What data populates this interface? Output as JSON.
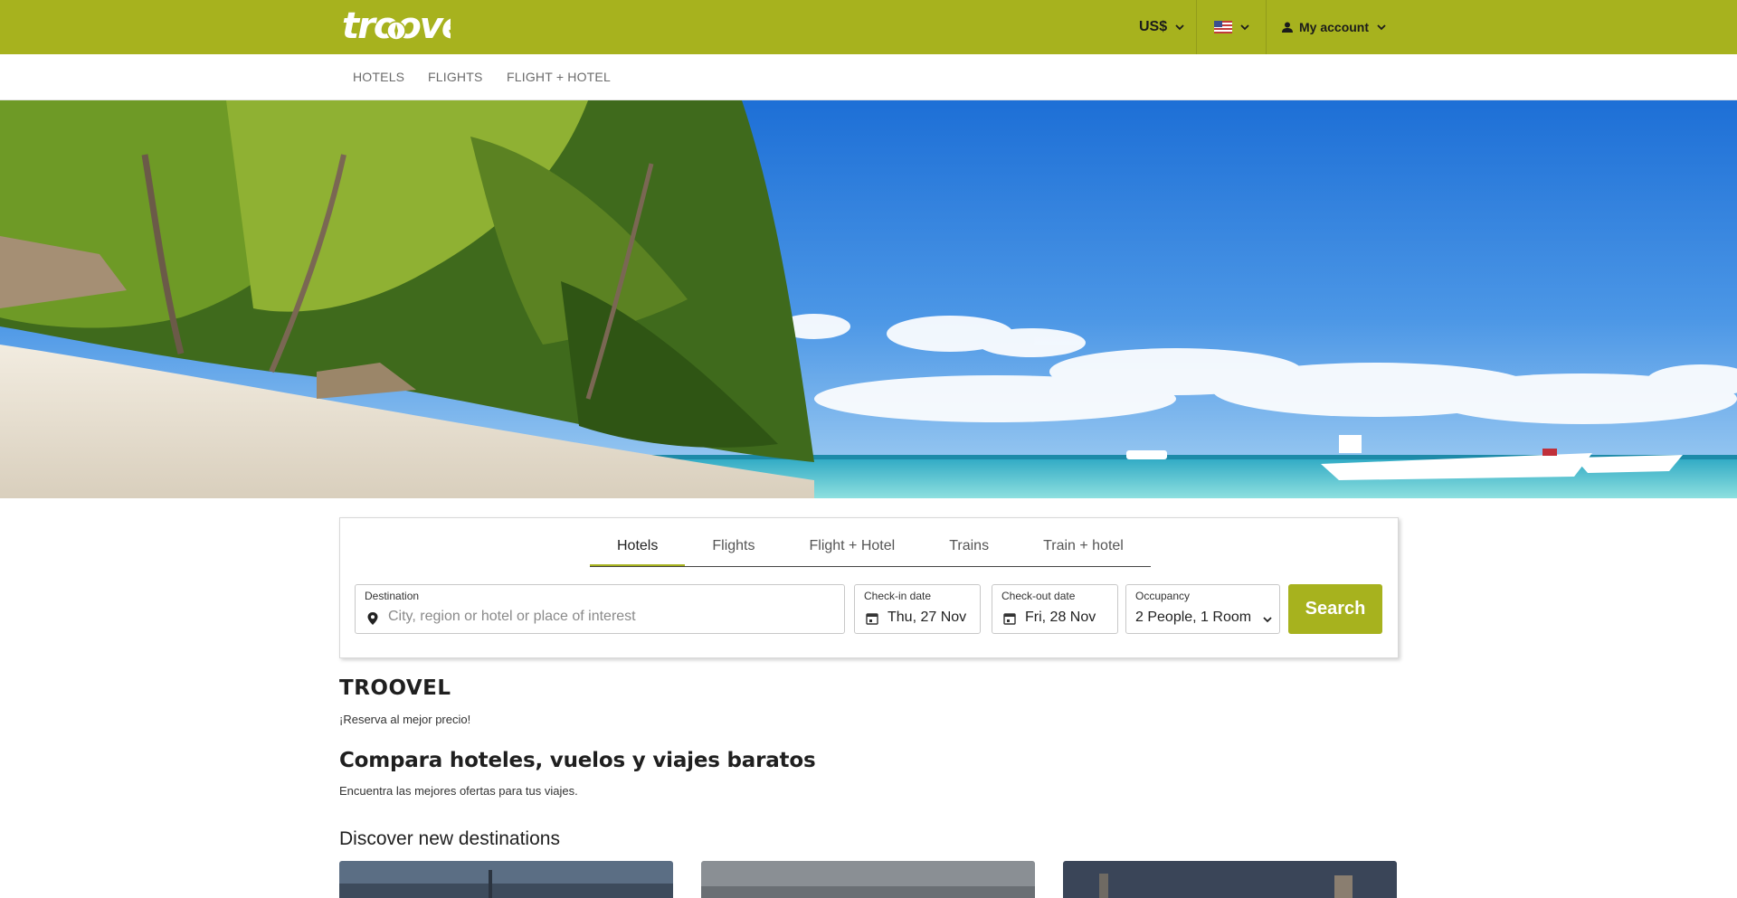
{
  "header": {
    "logo_text": "troovel",
    "currency": "US$",
    "language_flag": "us-flag",
    "account_label": "My account",
    "brand_color": "#a7b21e"
  },
  "subnav": {
    "items": [
      "HOTELS",
      "FLIGHTS",
      "FLIGHT + HOTEL"
    ]
  },
  "search": {
    "tabs": [
      "Hotels",
      "Flights",
      "Flight + Hotel",
      "Trains",
      "Train + hotel"
    ],
    "active_tab": "Hotels",
    "destination": {
      "label": "Destination",
      "placeholder": "City, region or hotel or place of interest",
      "value": ""
    },
    "checkin": {
      "label": "Check-in date",
      "value": "Thu, 27 Nov"
    },
    "checkout": {
      "label": "Check-out date",
      "value": "Fri, 28 Nov"
    },
    "occupancy": {
      "label": "Occupancy",
      "value": "2 People, 1 Room"
    },
    "button_label": "Search"
  },
  "content": {
    "brand_title": "TROOVEL",
    "brand_tagline": "¡Reserva al mejor precio!",
    "heading": "Compara hoteles, vuelos y viajes baratos",
    "subheading": "Encuentra las mejores ofertas para tus viajes.",
    "destinations_heading": "Discover new destinations"
  },
  "icons": {
    "chevron": "chevron-down-icon",
    "user": "user-icon",
    "location": "location-pin-icon",
    "calendar": "calendar-icon"
  }
}
